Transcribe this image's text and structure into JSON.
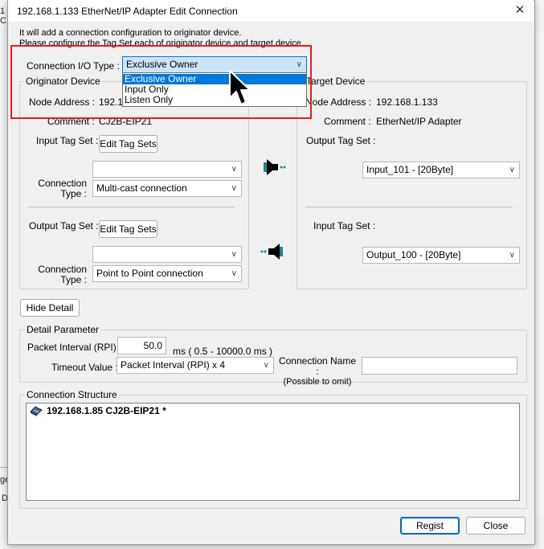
{
  "background": {
    "left_fragment_1": "1",
    "left_fragment_2": "C",
    "left_fragment_3": "ge",
    "left_fragment_4": "D"
  },
  "dialog": {
    "title": "192.168.1.133 EtherNet/IP Adapter Edit Connection",
    "close_label": "✕",
    "info_line_1": "It will add a connection configuration to originator device.",
    "info_line_2": "Please configure the Tag Set each of originator device and target device."
  },
  "connection_io": {
    "label": "Connection I/O Type :",
    "selected": "Exclusive Owner",
    "options": [
      "Exclusive Owner",
      "Input Only",
      "Listen Only"
    ]
  },
  "originator": {
    "legend": "Originator Device",
    "node_address_label": "Node Address :",
    "node_address_value": "192.168.1.85",
    "comment_label": "Comment :",
    "comment_value": "CJ2B-EIP21",
    "input_tag_set_label": "Input Tag Set :",
    "input_edit_button": "Edit Tag Sets",
    "input_tag_combo": "",
    "input_connection_type_label_1": "Connection",
    "input_connection_type_label_2": "Type :",
    "input_connection_type": "Multi-cast connection",
    "output_tag_set_label": "Output Tag Set :",
    "output_edit_button": "Edit Tag Sets",
    "output_tag_combo": "",
    "output_connection_type_label_1": "Connection",
    "output_connection_type_label_2": "Type :",
    "output_connection_type": "Point to Point connection"
  },
  "target": {
    "legend": "Target Device",
    "node_address_label": "Node Address :",
    "node_address_value": "192.168.1.133",
    "comment_label": "Comment :",
    "comment_value": "EtherNet/IP Adapter",
    "output_tag_set_label": "Output Tag Set :",
    "output_tag_value": "Input_101 - [20Byte]",
    "input_tag_set_label": "Input Tag Set :",
    "input_tag_value": "Output_100 - [20Byte]"
  },
  "hide_detail_button": "Hide Detail",
  "detail": {
    "legend": "Detail Parameter",
    "packet_interval_label": "Packet Interval (RPI) :",
    "packet_interval_value": "50.0",
    "packet_interval_range": "ms ( 0.5 - 10000.0 ms )",
    "timeout_label": "Timeout Value :",
    "timeout_value": "Packet Interval (RPI) x 4",
    "connection_name_label_1": "Connection Name :",
    "connection_name_label_2": "(Possible to omit)",
    "connection_name_value": ""
  },
  "structure": {
    "legend": "Connection Structure",
    "entry": "192.168.1.85 CJ2B-EIP21 *"
  },
  "footer": {
    "regist_button": "Regist",
    "close_button": "Close"
  },
  "colors": {
    "highlight_box": "#e01e1e",
    "selection": "#0078d7",
    "arrow_teal": "#1a8a8a"
  }
}
